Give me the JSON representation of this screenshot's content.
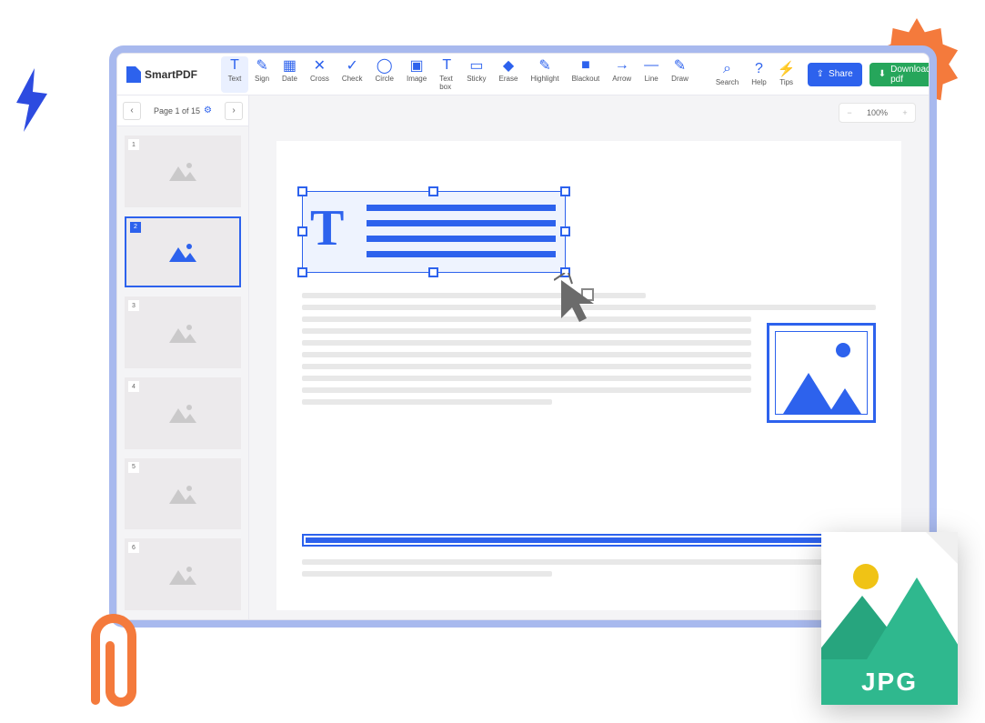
{
  "brand": "SmartPDF",
  "tools": [
    {
      "label": "Text",
      "icon": "T"
    },
    {
      "label": "Sign",
      "icon": "✎"
    },
    {
      "label": "Date",
      "icon": "▦"
    },
    {
      "label": "Cross",
      "icon": "✕"
    },
    {
      "label": "Check",
      "icon": "✓"
    },
    {
      "label": "Circle",
      "icon": "◯"
    },
    {
      "label": "Image",
      "icon": "▣"
    },
    {
      "label": "Text box",
      "icon": "T"
    },
    {
      "label": "Sticky",
      "icon": "▭"
    },
    {
      "label": "Erase",
      "icon": "◆"
    },
    {
      "label": "Highlight",
      "icon": "✎"
    },
    {
      "label": "Blackout",
      "icon": "■"
    },
    {
      "label": "Arrow",
      "icon": "→"
    },
    {
      "label": "Line",
      "icon": "—"
    },
    {
      "label": "Draw",
      "icon": "✎"
    }
  ],
  "right_tools": [
    {
      "label": "Search",
      "icon": "⌕"
    },
    {
      "label": "Help",
      "icon": "?"
    },
    {
      "label": "Tips",
      "icon": "⚡"
    }
  ],
  "share_label": "Share",
  "download_label": "Download pdf",
  "page_indicator": "Page 1 of 15",
  "zoom": "100%",
  "thumbnails": [
    1,
    2,
    3,
    4,
    5,
    6
  ],
  "selected_thumb": 2,
  "jpg_label": "JPG"
}
